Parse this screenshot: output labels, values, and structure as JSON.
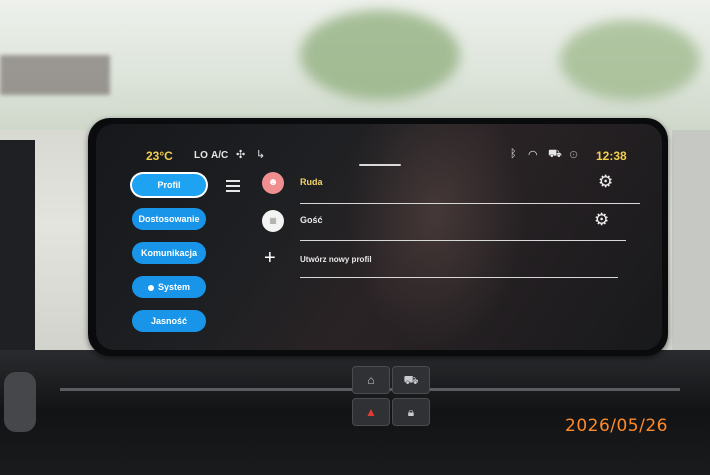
{
  "status_bar": {
    "temperature": "23°C",
    "fan_mode": "LO",
    "ac_label": "A/C",
    "fan_icon": "fan-icon",
    "airflow_icon": "airflow-icon",
    "bluetooth_icon": "bluetooth-icon",
    "wifi_icon": "wifi-icon",
    "car_icon": "car-icon",
    "location_icon": "location-icon",
    "clock": "12:38"
  },
  "sidebar": {
    "items": [
      {
        "label": "Profil",
        "active": true
      },
      {
        "label": "Dostosowanie",
        "active": false
      },
      {
        "label": "Komunikacja",
        "active": false
      },
      {
        "label": "System",
        "active": false
      },
      {
        "label": "Jasność",
        "active": false
      }
    ]
  },
  "profiles": [
    {
      "name": "Ruda",
      "avatar_icon": "user-avatar-icon",
      "settings_icon": "gear-icon"
    },
    {
      "name": "Gość",
      "avatar_icon": "guest-avatar-icon",
      "settings_icon": "gear-icon"
    }
  ],
  "create_profile": {
    "label": "Utwórz nowy profil",
    "icon": "plus-icon"
  },
  "console": {
    "buttons": [
      "home-icon",
      "car-icon",
      "hazard-icon",
      "lock-icon"
    ]
  },
  "photo_timestamp": "2026/05/26",
  "colors": {
    "accent_blue": "#1895e8",
    "status_yellow": "#f2cf4d",
    "avatar_pink": "#f08f8f",
    "timestamp_orange": "#ff8a2a"
  }
}
